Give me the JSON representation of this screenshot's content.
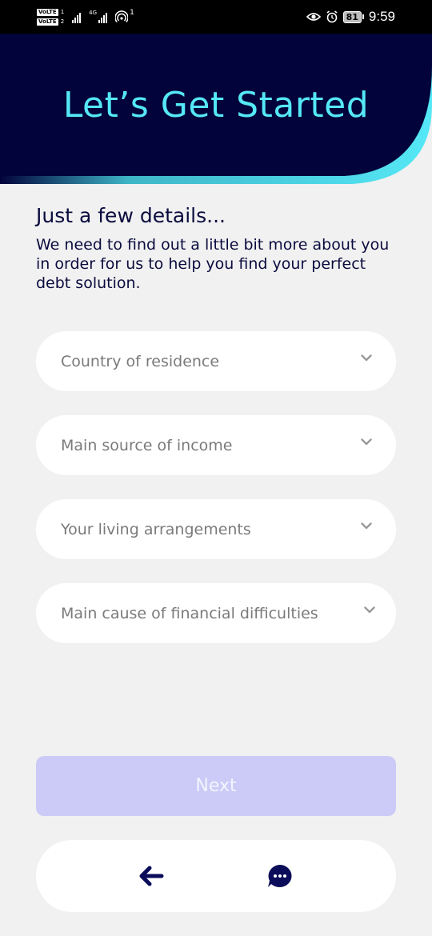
{
  "status_bar": {
    "sim1_badge": "VoLTE",
    "sim1_num": "1",
    "sim2_badge": "VoLTE",
    "sim2_num": "2",
    "net1": "4G",
    "hotspot_count": "1",
    "battery": "81",
    "time": "9:59"
  },
  "header": {
    "title": "Let’s Get Started",
    "bg_color": "#02033a",
    "accent_color": "#55e8f6"
  },
  "intro": {
    "heading": "Just a few details...",
    "body": "We need to find out a little bit more about you in order for us to help you find your perfect debt solution."
  },
  "fields": [
    {
      "placeholder": "Country of residence",
      "icon": "chevron-down-icon"
    },
    {
      "placeholder": "Main source of income",
      "icon": "chevron-down-icon"
    },
    {
      "placeholder": "Your living arrangements",
      "icon": "chevron-down-icon"
    },
    {
      "placeholder": "Main cause of financial difficulties",
      "icon": "chevron-down-icon"
    }
  ],
  "next_button": {
    "label": "Next",
    "color": "#cccbf7",
    "state": "disabled"
  },
  "bottom_nav": {
    "back_icon": "arrow-left-icon",
    "chat_icon": "chat-bubble-icon",
    "icon_color": "#0b0c5a"
  }
}
